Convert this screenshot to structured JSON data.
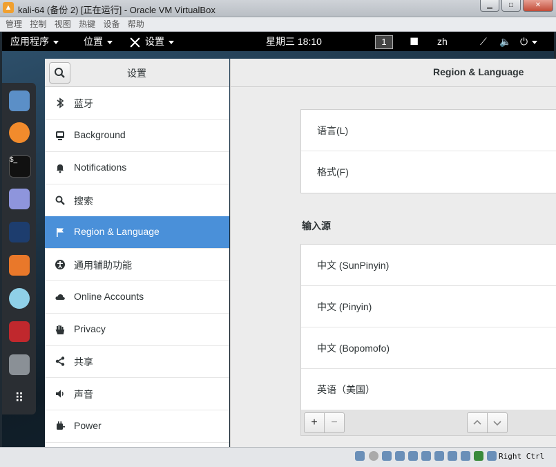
{
  "window": {
    "title": "kali-64 (备份 2) [正在运行] - Oracle VM VirtualBox",
    "menu": [
      "管理",
      "控制",
      "视图",
      "热键",
      "设备",
      "帮助"
    ]
  },
  "topbar": {
    "apps": "应用程序",
    "places": "位置",
    "settings": "设置",
    "clock": "星期三 18:10",
    "workspace": "1",
    "lang": "zh"
  },
  "dock": {
    "icons": [
      "files-icon",
      "firefox-icon",
      "terminal-icon",
      "text-editor-icon",
      "metasploit-icon",
      "burpsuite-icon",
      "eye-icon",
      "cherrytree-icon",
      "settings-icon",
      "app-grid-icon"
    ]
  },
  "settings": {
    "sidebar_title": "设置",
    "content_title": "Region & Language",
    "sidebar": [
      {
        "label": "蓝牙",
        "icon": "bluetooth-icon"
      },
      {
        "label": "Background",
        "icon": "background-icon"
      },
      {
        "label": "Notifications",
        "icon": "bell-icon"
      },
      {
        "label": "搜索",
        "icon": "search-icon"
      },
      {
        "label": "Region & Language",
        "icon": "flag-icon",
        "selected": true
      },
      {
        "label": "通用辅助功能",
        "icon": "accessibility-icon"
      },
      {
        "label": "Online Accounts",
        "icon": "cloud-icon"
      },
      {
        "label": "Privacy",
        "icon": "hand-icon"
      },
      {
        "label": "共享",
        "icon": "share-icon"
      },
      {
        "label": "声音",
        "icon": "speaker-icon"
      },
      {
        "label": "Power",
        "icon": "power-plug-icon"
      }
    ],
    "region": {
      "language": "语言(L)",
      "formats": "格式(F)"
    },
    "input_sources_label": "输入源",
    "input_sources": [
      "中文 (SunPinyin)",
      "中文 (Pinyin)",
      "中文 (Bopomofo)",
      "英语（美国）"
    ],
    "toolbar": {
      "add": "+",
      "remove": "−"
    }
  },
  "statusbar": {
    "host_key": "Right Ctrl"
  }
}
